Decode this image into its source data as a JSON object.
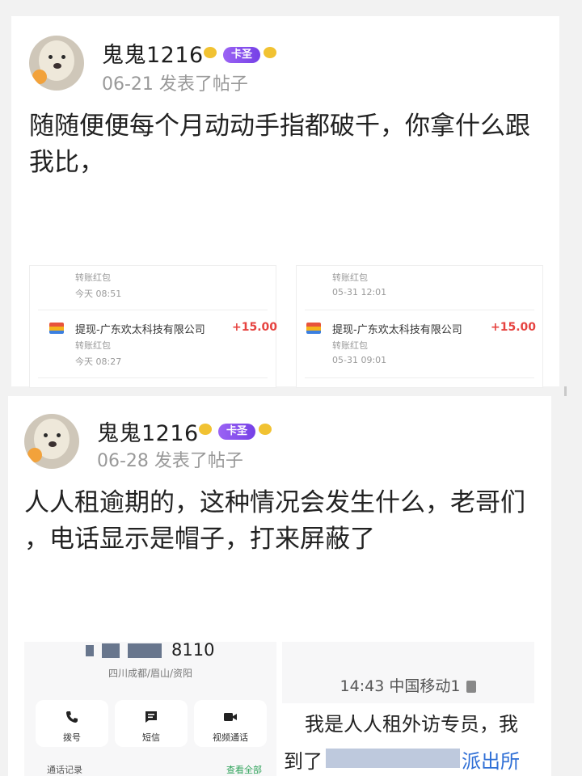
{
  "posts": [
    {
      "username": "鬼鬼1216",
      "badge": "卡圣",
      "meta": "06-21 发表了帖子",
      "text_lines": [
        "随随便便每个月动动手指都破千，你拿什么跟",
        "我比，"
      ],
      "receipts": [
        {
          "top_sub": "转账红包",
          "top_time": "今天 08:51",
          "company": "提现-广东欢太科技有限公司",
          "amount": "+15.00",
          "sub": "转账红包",
          "time": "今天 08:27"
        },
        {
          "top_sub": "转账红包",
          "top_time": "05-31 12:01",
          "company": "提现-广东欢太科技有限公司",
          "amount": "+15.00",
          "sub": "转账红包",
          "time": "05-31 09:01"
        }
      ]
    },
    {
      "username": "鬼鬼1216",
      "badge": "卡圣",
      "meta": "06-28 发表了帖子",
      "text_lines": [
        "人人租逾期的，这种情况会发生什么，老哥们",
        "，电话显示是帽子，打来屏蔽了"
      ],
      "phone": {
        "number_tail": "8110",
        "location": "四川成都/眉山/资阳",
        "buttons": [
          "拨号",
          "短信",
          "视频通话"
        ],
        "call_log": "通话记录",
        "view_all": "查看全部"
      },
      "sms": {
        "status": "14:43 中国移动1",
        "line1": "我是人人租外访专员，我",
        "line2_start": "到了",
        "line2_end": "派出所"
      }
    }
  ],
  "colors": {
    "amount": "#e64340",
    "badge": "#7540e6",
    "link": "#2f6fd6"
  }
}
